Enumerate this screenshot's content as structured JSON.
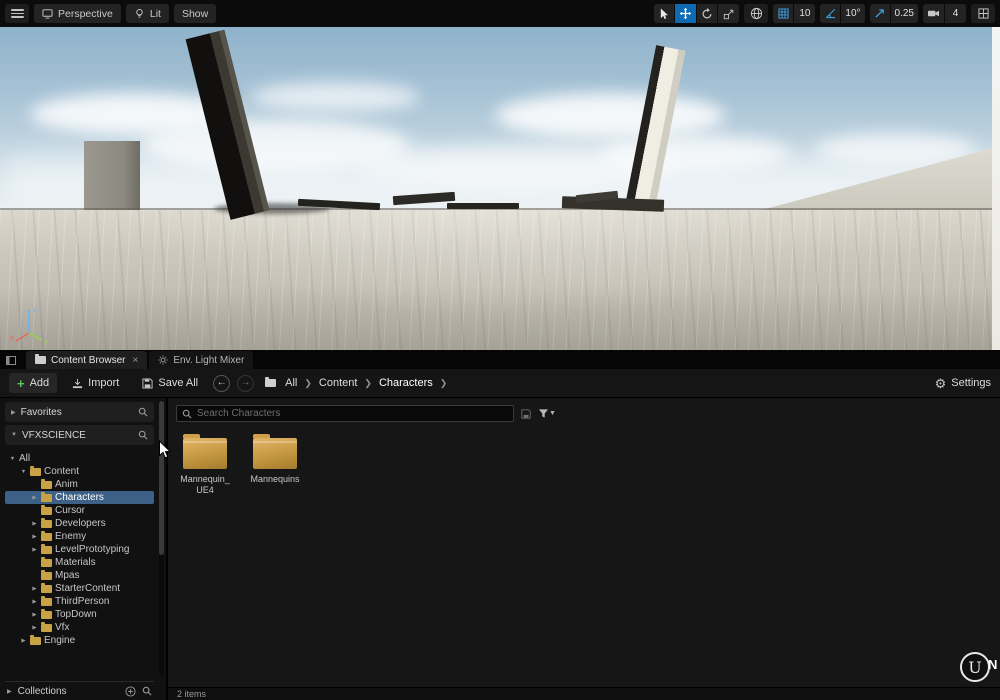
{
  "viewport_toolbar": {
    "perspective": "Perspective",
    "lit": "Lit",
    "show": "Show",
    "grid_snap": "10",
    "rotation_snap": "10°",
    "scale_snap": "0.25",
    "camera_speed": "4"
  },
  "viewport": {
    "gizmo": {
      "x": "x",
      "y": "y",
      "z": "z"
    }
  },
  "panel_tabs": {
    "content_browser": "Content Browser",
    "close": "×",
    "env_light_mixer": "Env. Light Mixer"
  },
  "cb_toolbar": {
    "add": "Add",
    "import": "Import",
    "save_all": "Save All",
    "breadcrumb": [
      "All",
      "Content",
      "Characters"
    ],
    "settings": "Settings"
  },
  "sidebar": {
    "favorites": "Favorites",
    "source": "VFXSCIENCE",
    "collections": "Collections",
    "tree": [
      {
        "label": "All",
        "depth": 0,
        "arrow": "expanded",
        "icon": null,
        "selected": false
      },
      {
        "label": "Content",
        "depth": 1,
        "arrow": "expanded",
        "icon": "folder",
        "selected": false
      },
      {
        "label": "Anim",
        "depth": 2,
        "arrow": null,
        "icon": "folder",
        "selected": false
      },
      {
        "label": "Characters",
        "depth": 2,
        "arrow": "collapsed",
        "icon": "folder",
        "selected": true
      },
      {
        "label": "Cursor",
        "depth": 2,
        "arrow": null,
        "icon": "folder",
        "selected": false
      },
      {
        "label": "Developers",
        "depth": 2,
        "arrow": "collapsed",
        "icon": "folder",
        "selected": false
      },
      {
        "label": "Enemy",
        "depth": 2,
        "arrow": "collapsed",
        "icon": "folder",
        "selected": false
      },
      {
        "label": "LevelPrototyping",
        "depth": 2,
        "arrow": "collapsed",
        "icon": "folder",
        "selected": false
      },
      {
        "label": "Materials",
        "depth": 2,
        "arrow": null,
        "icon": "folder",
        "selected": false
      },
      {
        "label": "Mpas",
        "depth": 2,
        "arrow": null,
        "icon": "folder",
        "selected": false
      },
      {
        "label": "StarterContent",
        "depth": 2,
        "arrow": "collapsed",
        "icon": "folder",
        "selected": false
      },
      {
        "label": "ThirdPerson",
        "depth": 2,
        "arrow": "collapsed",
        "icon": "folder",
        "selected": false
      },
      {
        "label": "TopDown",
        "depth": 2,
        "arrow": "collapsed",
        "icon": "folder",
        "selected": false
      },
      {
        "label": "Vfx",
        "depth": 2,
        "arrow": "collapsed",
        "icon": "folder",
        "selected": false
      },
      {
        "label": "Engine",
        "depth": 1,
        "arrow": "collapsed",
        "icon": "folder",
        "selected": false
      }
    ]
  },
  "content_area": {
    "search_placeholder": "Search Characters",
    "folders": [
      {
        "name": "Mannequin_UE4"
      },
      {
        "name": "Mannequins"
      }
    ],
    "status": "2 items"
  },
  "misc": {
    "logo_letter": "U",
    "cutoff_text": "N"
  },
  "colors": {
    "selection_blue": "#3d6086",
    "folder_gold": "#c9a245",
    "accent_blue": "#3fa7e8",
    "add_green": "#5fc35f"
  }
}
